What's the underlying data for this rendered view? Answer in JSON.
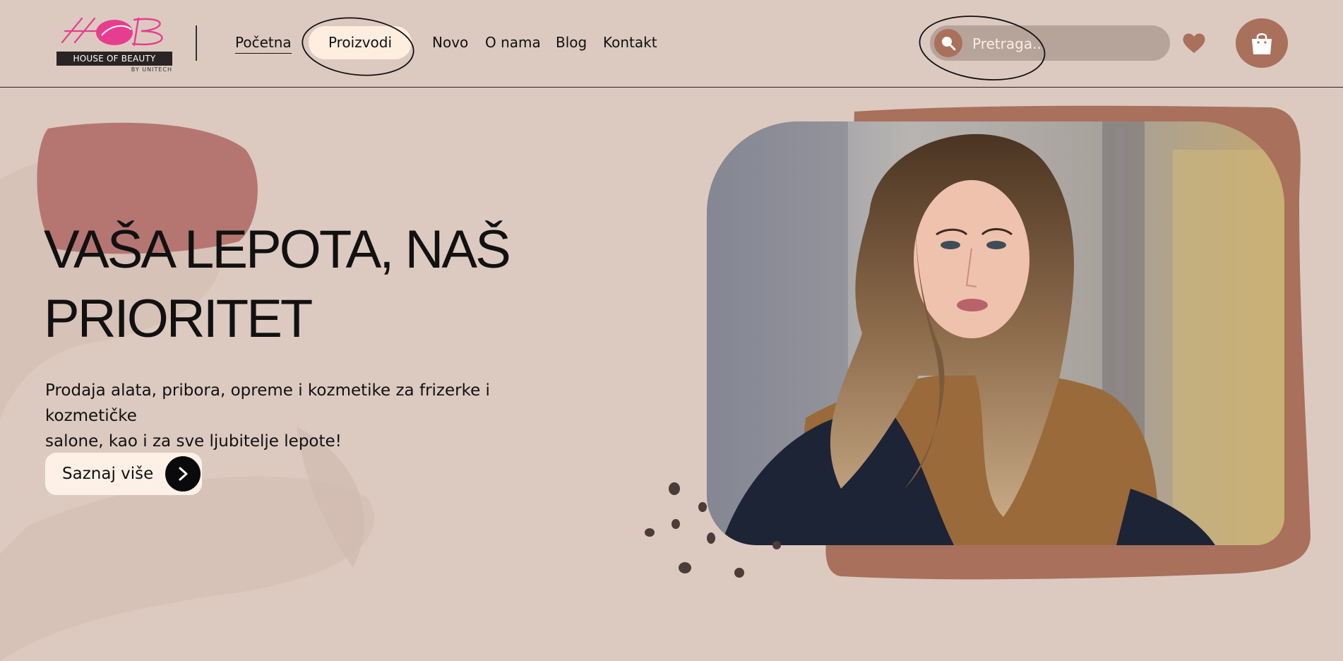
{
  "brand": {
    "name": "HOUSE OF BEAUTY",
    "tagline": "BY UNITECH",
    "mark": "HOB",
    "colors": {
      "pink": "#e73d8f",
      "terracotta": "#a9705c",
      "background": "#dccac0",
      "cream": "#fdeee0"
    }
  },
  "nav": {
    "items": [
      {
        "label": "Početna",
        "active": true
      },
      {
        "label": "Proizvodi",
        "highlighted": true
      },
      {
        "label": "Novo"
      },
      {
        "label": "O nama"
      },
      {
        "label": "Blog"
      },
      {
        "label": "Kontakt"
      }
    ]
  },
  "search": {
    "placeholder": "Pretraga...",
    "icon": "search-icon"
  },
  "actions": {
    "wishlist_icon": "heart-icon",
    "cart_icon": "shopping-bag-icon"
  },
  "hero": {
    "title_line1": "VAŠA LEPOTA, NAŠ",
    "title_line2": "PRIORITET",
    "subtitle_line1": "Prodaja alata, pribora, opreme i kozmetike za frizerke i kozmetičke",
    "subtitle_line2": "salone, kao i za sve ljubitelje lepote!",
    "cta_label": "Saznaj više",
    "cta_icon": "chevron-right-icon",
    "image_subject": "woman with long wavy hair"
  }
}
